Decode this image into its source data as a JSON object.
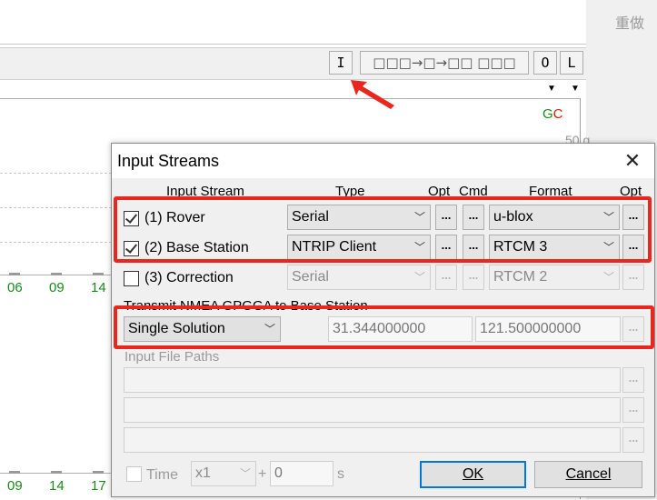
{
  "background": {
    "redo_label": "重做",
    "toolbar": {
      "input_button": "I",
      "stream_indicator": "□□□→□→□□ □□□",
      "output_button": "O",
      "log_button": "L"
    },
    "plot": {
      "gc_g": "G",
      "gc_c": "C",
      "tick_top": "50",
      "tick_partial": "g",
      "row1_labels": [
        "06",
        "09",
        "14"
      ],
      "row2_labels": [
        "09",
        "14",
        "17"
      ]
    }
  },
  "dialog": {
    "title": "Input Streams",
    "close_icon": "close-icon",
    "headers": {
      "input_stream": "Input Stream",
      "type": "Type",
      "opt": "Opt",
      "cmd": "Cmd",
      "format": "Format",
      "opt2": "Opt"
    },
    "streams": [
      {
        "label": "(1) Rover",
        "checked": true,
        "type": "Serial",
        "format": "u-blox",
        "enabled": true
      },
      {
        "label": "(2) Base Station",
        "checked": true,
        "type": "NTRIP Client",
        "format": "RTCM 3",
        "enabled": true
      },
      {
        "label": "(3) Correction",
        "checked": false,
        "type": "Serial",
        "format": "RTCM 2",
        "enabled": false
      }
    ],
    "dots": "...",
    "nmea": {
      "label": "Transmit NMEA GPGGA to Base Station",
      "mode": "Single Solution",
      "latitude": "31.344000000",
      "longitude": "121.500000000"
    },
    "input_file_paths": {
      "label": "Input File Paths"
    },
    "time": {
      "label": "Time",
      "speed": "x1",
      "plus": "+",
      "offset": "0",
      "unit": "s"
    },
    "ok_button": "OK",
    "cancel_button": "Cancel"
  },
  "annotation_color": "#e8281e"
}
